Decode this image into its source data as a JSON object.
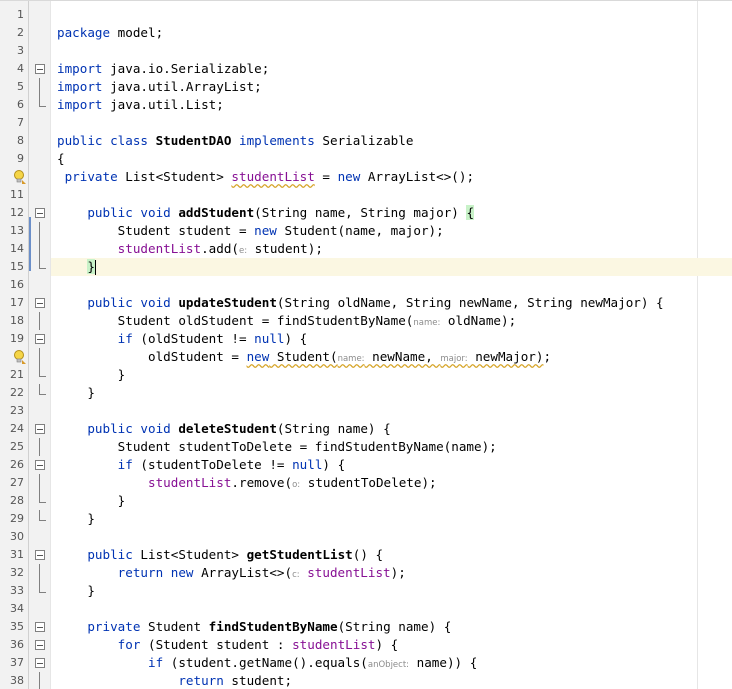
{
  "editor": {
    "current_line": 15,
    "hints": {
      "e": "e:",
      "name": "name:",
      "major": "major:",
      "o": "o:",
      "c": "c:",
      "anObject": "anObject:"
    },
    "lines": [
      {
        "n": "1"
      },
      {
        "n": "2",
        "text": "package model;"
      },
      {
        "n": "3"
      },
      {
        "n": "4",
        "text": "import java.io.Serializable;"
      },
      {
        "n": "5",
        "text": "import java.util.ArrayList;"
      },
      {
        "n": "6",
        "text": "import java.util.List;"
      },
      {
        "n": "7"
      },
      {
        "n": "8",
        "text": "public class StudentDAO implements Serializable"
      },
      {
        "n": "9",
        "text": "{"
      },
      {
        "n": "10",
        "text": " private List<Student> studentList = new ArrayList<>();"
      },
      {
        "n": "11"
      },
      {
        "n": "12",
        "text": "    public void addStudent(String name, String major) {"
      },
      {
        "n": "13",
        "text": "        Student student = new Student(name, major);"
      },
      {
        "n": "14",
        "text": "        studentList.add(student);"
      },
      {
        "n": "15",
        "text": "    }"
      },
      {
        "n": "16"
      },
      {
        "n": "17",
        "text": "    public void updateStudent(String oldName, String newName, String newMajor) {"
      },
      {
        "n": "18",
        "text": "        Student oldStudent = findStudentByName(oldName);"
      },
      {
        "n": "19",
        "text": "        if (oldStudent != null) {"
      },
      {
        "n": "20",
        "text": "            oldStudent = new Student(newName, newMajor);"
      },
      {
        "n": "21",
        "text": "        }"
      },
      {
        "n": "22",
        "text": "    }"
      },
      {
        "n": "23"
      },
      {
        "n": "24",
        "text": "    public void deleteStudent(String name) {"
      },
      {
        "n": "25",
        "text": "        Student studentToDelete = findStudentByName(name);"
      },
      {
        "n": "26",
        "text": "        if (studentToDelete != null) {"
      },
      {
        "n": "27",
        "text": "            studentList.remove(studentToDelete);"
      },
      {
        "n": "28",
        "text": "        }"
      },
      {
        "n": "29",
        "text": "    }"
      },
      {
        "n": "30"
      },
      {
        "n": "31",
        "text": "    public List<Student> getStudentList() {"
      },
      {
        "n": "32",
        "text": "        return new ArrayList<>(studentList);"
      },
      {
        "n": "33",
        "text": "    }"
      },
      {
        "n": "34"
      },
      {
        "n": "35",
        "text": "    private Student findStudentByName(String name) {"
      },
      {
        "n": "36",
        "text": "        for (Student student : studentList) {"
      },
      {
        "n": "37",
        "text": "            if (student.getName().equals(name)) {"
      },
      {
        "n": "38",
        "text": "                return student;"
      }
    ],
    "colors": {
      "keyword": "#0033b3",
      "field": "#871094",
      "hint": "#8c8c8c",
      "current_line_bg": "#fbf7e2",
      "gutter_bg": "#f2f2f2",
      "brace_match_bg": "#c8f2c8",
      "warning_underline": "#d6a52a"
    },
    "icons": {
      "line_10": "intention-bulb-icon",
      "line_20": "intention-bulb-icon"
    }
  }
}
